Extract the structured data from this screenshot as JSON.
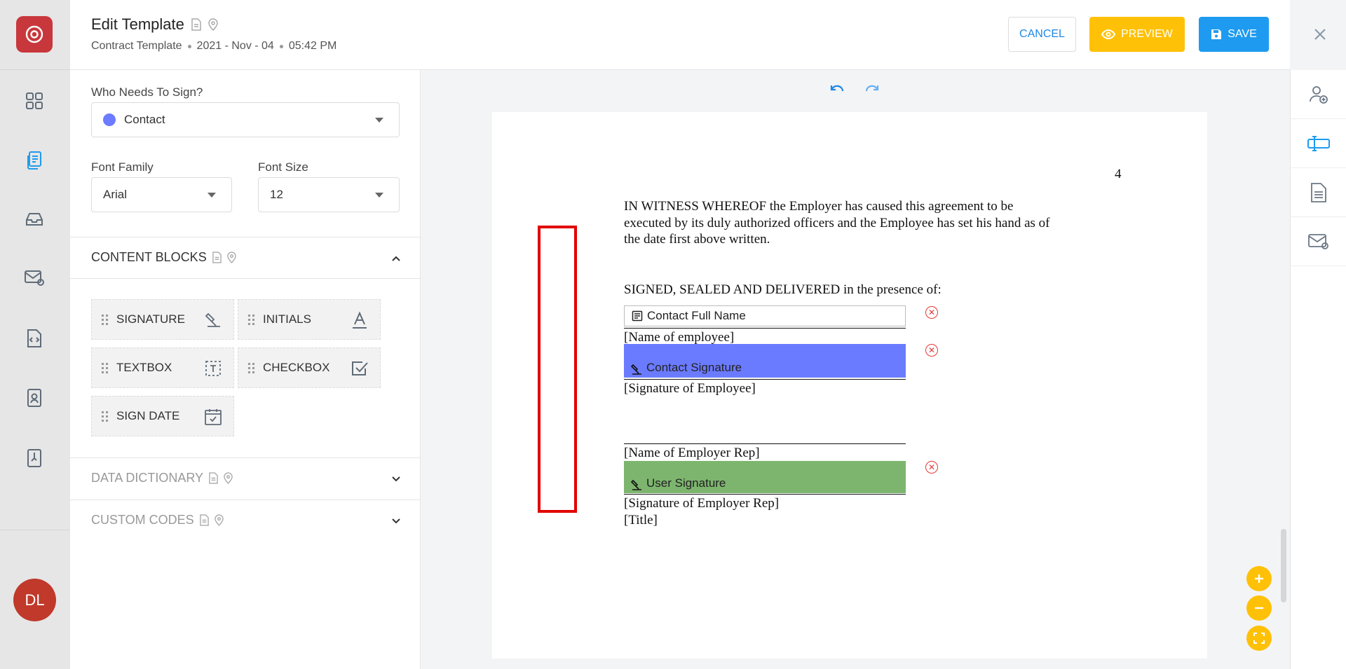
{
  "header": {
    "title": "Edit Template",
    "subtitle_type": "Contract Template",
    "subtitle_date": "2021 - Nov - 04",
    "subtitle_time": "05:42 PM",
    "cancel_label": "CANCEL",
    "preview_label": "PREVIEW",
    "save_label": "SAVE"
  },
  "user": {
    "initials": "DL"
  },
  "settings": {
    "signer_label": "Who Needs To Sign?",
    "signer_value": "Contact",
    "font_family_label": "Font Family",
    "font_family_value": "Arial",
    "font_size_label": "Font Size",
    "font_size_value": "12"
  },
  "sections": {
    "content_blocks": "CONTENT BLOCKS",
    "data_dictionary": "DATA DICTIONARY",
    "custom_codes": "CUSTOM CODES"
  },
  "blocks": {
    "signature": "SIGNATURE",
    "initials": "INITIALS",
    "textbox": "TEXTBOX",
    "checkbox": "CHECKBOX",
    "sign_date": "SIGN DATE"
  },
  "document": {
    "page_number": "4",
    "witness_paragraph": "IN WITNESS WHEREOF the Employer has caused this agreement to be executed by its duly authorized officers and the Employee has set his hand as of the date first above written.",
    "signed_line": "SIGNED, SEALED AND DELIVERED in the presence of:",
    "name_employee": "[Name of employee]",
    "signature_employee": "[Signature of Employee]",
    "name_employer_rep": "[Name of Employer Rep]",
    "signature_employer_rep": "[Signature of Employer Rep]",
    "title": "[Title]",
    "field_contact_full_name": "Contact Full Name",
    "field_contact_signature": "Contact Signature",
    "field_user_signature": "User Signature"
  },
  "colors": {
    "brand": "#c8373c",
    "accent_blue": "#1e9bf0",
    "accent_yellow": "#ffc107",
    "contact_color": "#6b7bff",
    "user_color": "#7db56e",
    "highlight": "#e10000"
  }
}
